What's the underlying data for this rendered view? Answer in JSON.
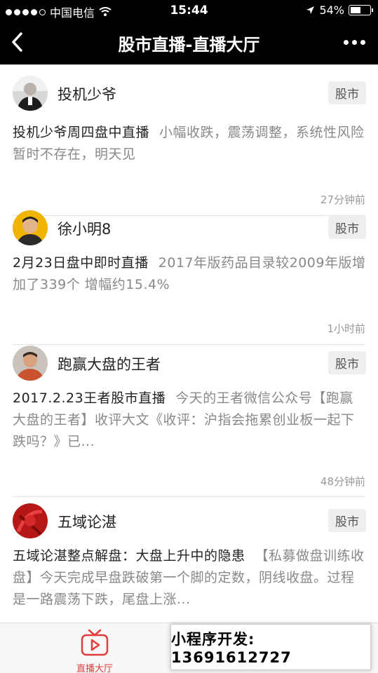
{
  "status_bar": {
    "carrier": "中国电信",
    "time": "15:44",
    "battery_text": "54%",
    "battery_level": 0.54,
    "signal_icon": "signal-dots-icon",
    "wifi_icon": "wifi-icon",
    "location_icon": "location-arrow-icon"
  },
  "nav": {
    "title": "股市直播-直播大厅",
    "back_icon": "back-chevron-icon",
    "more_icon": "more-dots-icon"
  },
  "posts": [
    {
      "author": "投机少爷",
      "tag": "股市",
      "lead": "投机少爷周四盘中直播",
      "summary": "小幅收跌，震荡调整，系统性风险暂时不存在，明天见",
      "time": "27分钟前"
    },
    {
      "author": "徐小明8",
      "tag": "股市",
      "lead": "2月23日盘中即时直播",
      "summary": "2017年版药品目录较2009年版增加了339个 增幅约15.4%",
      "time": "1小时前"
    },
    {
      "author": "跑赢大盘的王者",
      "tag": "股市",
      "lead": "2017.2.23王者股市直播",
      "summary": "今天的王者微信公众号【跑赢大盘的王者】收评大文《收评：沪指会拖累创业板一起下跌吗？》已...",
      "time": "48分钟前"
    },
    {
      "author": "五域论湛",
      "tag": "股市",
      "lead": "五域论湛整点解盘：大盘上升中的隐患",
      "summary": "【私募做盘训练收盘】今天完成早盘跌破第一个脚的定数，阴线收盘。过程是一路震荡下跌，尾盘上涨...",
      "time": ""
    }
  ],
  "tabbar": {
    "live_label": "直播大厅",
    "live_icon": "tv-play-icon",
    "accent": "#e23b3b"
  },
  "promo": {
    "text": "小程序开发: 13691612727"
  },
  "colors": {
    "bar_bg": "#000000",
    "muted_text": "#888888",
    "tag_bg": "#eeeeee"
  }
}
